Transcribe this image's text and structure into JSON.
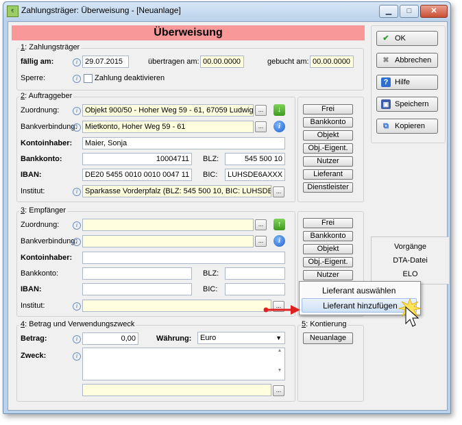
{
  "window": {
    "title": "Zahlungsträger: Überweisung - [Neuanlage]",
    "controls": {
      "minimize": "▁",
      "maximize": "□",
      "close": "✕"
    }
  },
  "header": "Überweisung",
  "section1": {
    "title_num": "1",
    "title": ": Zahlungsträger",
    "faellig_label": "fällig am:",
    "faellig_value": "29.07.2015",
    "uebertragen_label": "übertragen am:",
    "uebertragen_value": "00.00.0000",
    "gebucht_label": "gebucht am:",
    "gebucht_value": "00.00.0000",
    "sperre_label": "Sperre:",
    "zahlung_deaktivieren": "Zahlung deaktivieren"
  },
  "section2": {
    "title_num": "2",
    "title": ": Auftraggeber",
    "zuordnung_label": "Zuordnung:",
    "zuordnung_value": "Objekt 900/50 - Hoher Weg 59 - 61, 67059 Ludwig",
    "bankverbindung_label": "Bankverbindung:",
    "bankverbindung_value": "Mietkonto,  Hoher Weg 59 - 61",
    "kontoinhaber_label": "Kontoinhaber:",
    "kontoinhaber_value": "Maier, Sonja",
    "bankkonto_label": "Bankkonto:",
    "bankkonto_value": "10004711",
    "blz_label": "BLZ:",
    "blz_value": "545 500 10",
    "iban_label": "IBAN:",
    "iban_value": "DE20 5455 0010 0010 0047 11",
    "bic_label": "BIC:",
    "bic_value": "LUHSDE6AXXX",
    "institut_label": "Institut:",
    "institut_value": "Sparkasse Vorderpfalz  (BLZ: 545 500 10,  BIC: LUHSDE"
  },
  "section2_buttons": [
    "Frei",
    "Bankkonto",
    "Objekt",
    "Obj.-Eigent.",
    "Nutzer",
    "Lieferant",
    "Dienstleister"
  ],
  "section3": {
    "title_num": "3",
    "title": ": Empfänger",
    "zuordnung_label": "Zuordnung:",
    "bankverbindung_label": "Bankverbindung:",
    "kontoinhaber_label": "Kontoinhaber:",
    "bankkonto_label": "Bankkonto:",
    "blz_label": "BLZ:",
    "iban_label": "IBAN:",
    "bic_label": "BIC:",
    "institut_label": "Institut:"
  },
  "section3_buttons": [
    "Frei",
    "Bankkonto",
    "Objekt",
    "Obj.-Eigent.",
    "Nutzer"
  ],
  "section4": {
    "title_num": "4",
    "title": ": Betrag und Verwendungszweck",
    "betrag_label": "Betrag:",
    "betrag_value": "0,00",
    "waehrung_label": "Währung:",
    "waehrung_value": "Euro",
    "zweck_label": "Zweck:"
  },
  "section5": {
    "title_num": "5",
    "title": ": Kontierung",
    "button": "Neuanlage"
  },
  "right_buttons": {
    "ok": "OK",
    "abbrechen": "Abbrechen",
    "hilfe": "Hilfe",
    "speichern": "Speichern",
    "kopieren": "Kopieren"
  },
  "side_box": [
    "Vorgänge",
    "DTA-Datei",
    "ELO"
  ],
  "popup_menu": [
    "Lieferant auswählen",
    "Lieferant hinzufügen"
  ],
  "dots_label": "...",
  "colors": {
    "header_red": "#f89898",
    "field_yellow": "#ffffe0",
    "arrow_red": "#e02020"
  }
}
